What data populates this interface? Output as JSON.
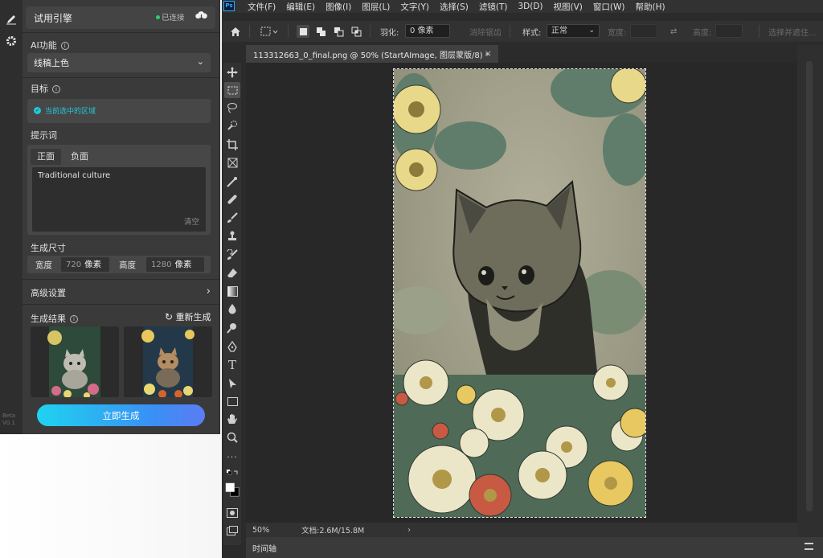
{
  "photoshop": {
    "logo": "Ps",
    "menus": [
      "文件(F)",
      "编辑(E)",
      "图像(I)",
      "图层(L)",
      "文字(Y)",
      "选择(S)",
      "滤镜(T)",
      "3D(D)",
      "视图(V)",
      "窗口(W)",
      "帮助(H)"
    ],
    "options": {
      "feather_label": "羽化:",
      "feather_value": "0 像素",
      "antialias_label": "消除锯齿",
      "style_label": "样式:",
      "style_value": "正常",
      "width_label": "宽度:",
      "height_label": "高度:",
      "select_mask_label": "选择并遮住..."
    },
    "document_tab": {
      "title": "113312663_0_final.png @ 50% (StartAImage, 图层蒙版/8) *",
      "close": "×"
    },
    "status": {
      "zoom": "50%",
      "doc_info": "文档:2.6M/15.8M",
      "arrow": "›"
    },
    "timeline_label": "时间轴",
    "tools": [
      "move-tool",
      "marquee-tool",
      "lasso-tool",
      "quick-select-tool",
      "crop-tool",
      "frame-tool",
      "eyedropper-tool",
      "healing-tool",
      "brush-tool",
      "stamp-tool",
      "history-brush-tool",
      "eraser-tool",
      "gradient-tool",
      "blur-tool",
      "dodge-tool",
      "pen-tool",
      "type-tool",
      "path-select-tool",
      "shape-tool",
      "hand-tool",
      "zoom-tool",
      "more-tools"
    ]
  },
  "plugin": {
    "engine_title": "试用引擎",
    "connection_status": "已连接",
    "ai_function_label": "AI功能",
    "ai_function_value": "线稿上色",
    "target_label": "目标",
    "target_value": "当前选中的区域",
    "prompt_label": "提示词",
    "prompt_tab_positive": "正面",
    "prompt_tab_negative": "负面",
    "prompt_text": "Traditional culture",
    "clear_label": "清空",
    "size_label": "生成尺寸",
    "width_label": "宽度",
    "width_value": "720",
    "height_label": "高度",
    "height_value": "1280",
    "unit": "像素",
    "advanced_label": "高级设置",
    "results_label": "生成结果",
    "regenerate_label": "重新生成",
    "generate_button": "立即生成",
    "beta_label": "Beta V0.1"
  },
  "colors": {
    "accent_cyan": "#21c7d9",
    "connected_green": "#2ecc71",
    "gradient_start": "#1fd3f0",
    "gradient_end": "#5b7cf4"
  }
}
